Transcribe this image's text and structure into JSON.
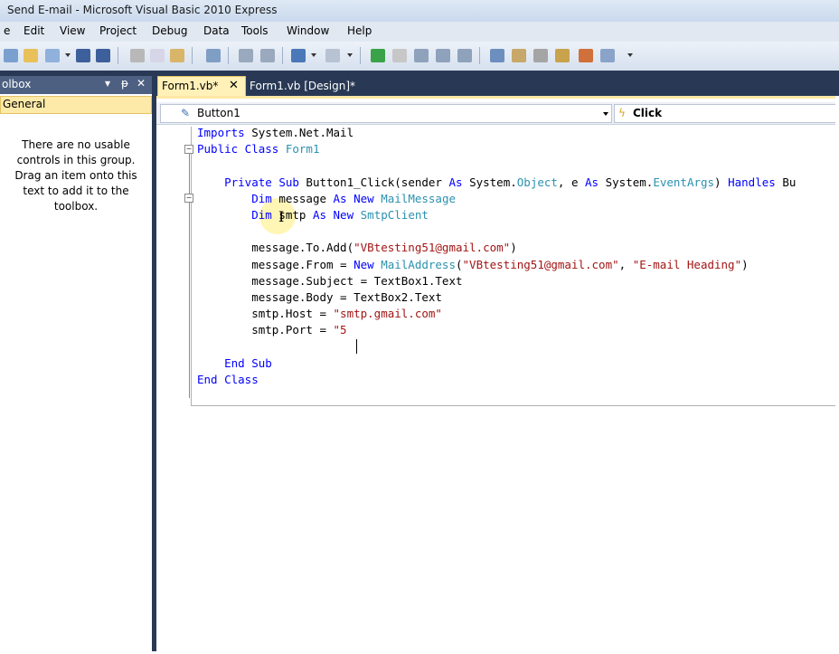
{
  "window": {
    "title": "Send E-mail - Microsoft Visual Basic 2010 Express"
  },
  "menu": [
    "e",
    "Edit",
    "View",
    "Project",
    "Debug",
    "Data",
    "Tools",
    "Window",
    "Help"
  ],
  "toolbox": {
    "title": "olbox",
    "pin_icon": "pin-icon",
    "close_icon": "close-icon",
    "group": "General",
    "empty_message": "There are no usable controls in this group. Drag an item onto this text to add it to the toolbox."
  },
  "tabs": [
    {
      "label": "Form1.vb*",
      "active": true
    },
    {
      "label": "Form1.vb [Design]*",
      "active": false
    }
  ],
  "navigation": {
    "object": "Button1",
    "event": "Click"
  },
  "code": {
    "lines": [
      [
        [
          "kw",
          "Imports"
        ],
        [
          "",
          " System.Net.Mail"
        ]
      ],
      [
        [
          "kw",
          "Public Class"
        ],
        [
          "",
          " "
        ],
        [
          "ty",
          "Form1"
        ]
      ],
      [],
      [
        [
          "",
          "    "
        ],
        [
          "kw",
          "Private Sub"
        ],
        [
          "",
          " Button1_Click(sender "
        ],
        [
          "kw",
          "As"
        ],
        [
          "",
          " System."
        ],
        [
          "ty",
          "Object"
        ],
        [
          "",
          ", e "
        ],
        [
          "kw",
          "As"
        ],
        [
          "",
          " System."
        ],
        [
          "ty",
          "EventArgs"
        ],
        [
          "",
          ") "
        ],
        [
          "kw",
          "Handles"
        ],
        [
          "",
          " Bu"
        ]
      ],
      [
        [
          "",
          "        "
        ],
        [
          "kw",
          "Dim"
        ],
        [
          "",
          " message "
        ],
        [
          "kw",
          "As New"
        ],
        [
          "",
          " "
        ],
        [
          "ty",
          "MailMessage"
        ]
      ],
      [
        [
          "",
          "        "
        ],
        [
          "kw",
          "Dim"
        ],
        [
          "",
          " smtp "
        ],
        [
          "kw",
          "As New"
        ],
        [
          "",
          " "
        ],
        [
          "ty",
          "SmtpClient"
        ]
      ],
      [],
      [
        [
          "",
          "        message.To.Add("
        ],
        [
          "st",
          "\"VBtesting51@gmail.com\""
        ],
        [
          "",
          ")"
        ]
      ],
      [
        [
          "",
          "        message.From = "
        ],
        [
          "kw",
          "New"
        ],
        [
          "",
          " "
        ],
        [
          "ty",
          "MailAddress"
        ],
        [
          "",
          "("
        ],
        [
          "st",
          "\"VBtesting51@gmail.com\""
        ],
        [
          "",
          ", "
        ],
        [
          "st",
          "\"E-mail Heading\""
        ],
        [
          "",
          ")"
        ]
      ],
      [
        [
          "",
          "        message.Subject = TextBox1.Text"
        ]
      ],
      [
        [
          "",
          "        message.Body = TextBox2.Text"
        ]
      ],
      [
        [
          "",
          "        smtp.Host = "
        ],
        [
          "st",
          "\"smtp.gmail.com\""
        ]
      ],
      [
        [
          "",
          "        smtp.Port = "
        ],
        [
          "st",
          "\"5"
        ]
      ],
      [],
      [
        [
          "",
          "    "
        ],
        [
          "kw",
          "End Sub"
        ]
      ],
      [
        [
          "kw",
          "End Class"
        ]
      ]
    ]
  },
  "colors": {
    "keyword": "#0000ff",
    "type": "#2b91af",
    "string": "#a31515",
    "ide_background": "#293955",
    "active_tab": "#fff1b8"
  }
}
